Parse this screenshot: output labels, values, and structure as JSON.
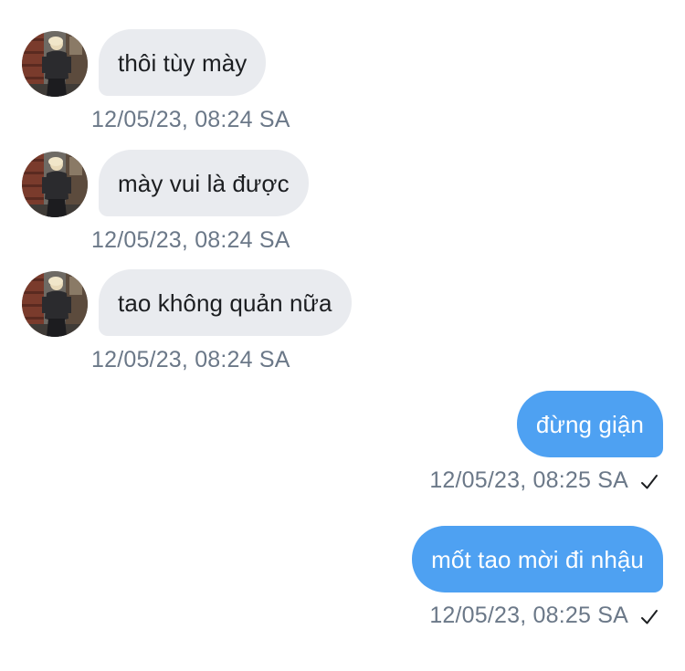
{
  "messages": [
    {
      "direction": "incoming",
      "text": "thôi tùy mày",
      "time": "12/05/23, 08:24 SA",
      "avatar": "user-avatar"
    },
    {
      "direction": "incoming",
      "text": "mày vui là được",
      "time": "12/05/23, 08:24 SA",
      "avatar": "user-avatar"
    },
    {
      "direction": "incoming",
      "text": "tao không quản nữa",
      "time": "12/05/23, 08:24 SA",
      "avatar": "user-avatar"
    },
    {
      "direction": "outgoing",
      "text": "đừng giận",
      "time": "12/05/23, 08:25 SA",
      "status_icon": "check-icon"
    },
    {
      "direction": "outgoing",
      "text": "mốt tao mời đi nhậu",
      "time": "12/05/23, 08:25 SA",
      "status_icon": "check-icon"
    }
  ],
  "colors": {
    "incoming_bubble": "#e9ebef",
    "outgoing_bubble": "#4ea1f2",
    "timestamp": "#6b7888"
  }
}
